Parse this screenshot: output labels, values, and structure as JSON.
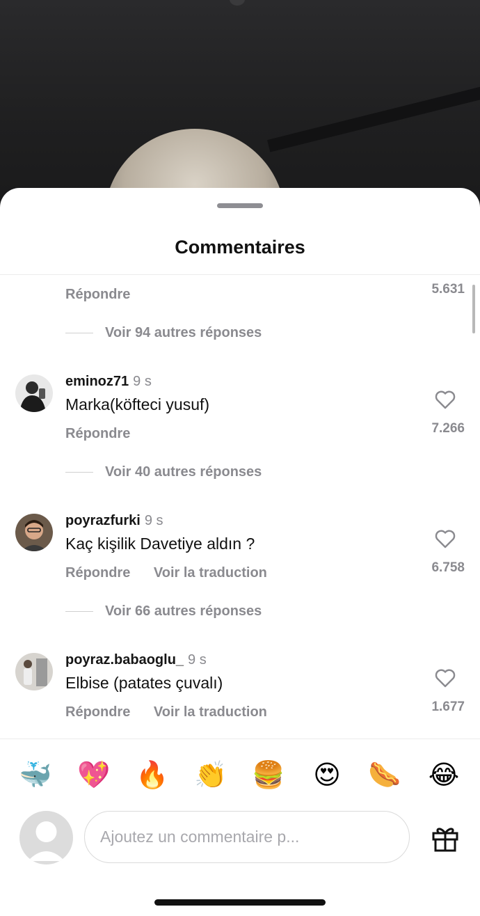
{
  "sheet": {
    "title": "Commentaires"
  },
  "top_reply": {
    "reply_label": "Répondre",
    "like_count": "5.631",
    "more_replies": "Voir 94 autres réponses"
  },
  "comments": [
    {
      "username": "eminoz71",
      "time": "9 s",
      "text": "Marka(köfteci yusuf)",
      "reply_label": "Répondre",
      "translate_label": "",
      "like_count": "7.266",
      "more_replies": "Voir 40 autres réponses"
    },
    {
      "username": "poyrazfurki",
      "time": "9 s",
      "text": "Kaç kişilik Davetiye aldın ?",
      "reply_label": "Répondre",
      "translate_label": "Voir la traduction",
      "like_count": "6.758",
      "more_replies": "Voir 66 autres réponses"
    },
    {
      "username": "poyraz.babaoglu_",
      "time": "9 s",
      "text": "Elbise (patates çuvalı)",
      "reply_label": "Répondre",
      "translate_label": "Voir la traduction",
      "like_count": "1.677"
    }
  ],
  "emoji_bar": [
    "🐳",
    "💖",
    "🔥",
    "👏",
    "🍔",
    "😍",
    "🌭",
    "😂"
  ],
  "input": {
    "placeholder": "Ajoutez un commentaire p..."
  },
  "icons": {
    "like": "heart-outline-icon",
    "gift": "gift-icon",
    "avatar": "default-avatar-icon"
  }
}
